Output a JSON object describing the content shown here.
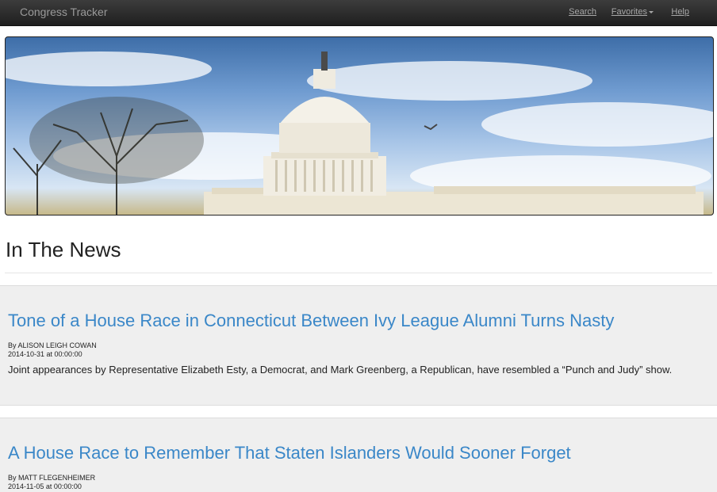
{
  "app": {
    "brand": "Congress Tracker"
  },
  "nav": {
    "search": "Search",
    "favorites": "Favorites",
    "help": "Help"
  },
  "page": {
    "heading": "In The News"
  },
  "articles": [
    {
      "headline": "Tone of a House Race in Connecticut Between Ivy League Alumni Turns Nasty",
      "byline": "By ALISON LEIGH COWAN",
      "date": "2014-10-31 at 00:00:00",
      "summary": "Joint appearances by Representative Elizabeth Esty, a Democrat, and Mark Greenberg, a Republican, have resembled a “Punch and Judy” show."
    },
    {
      "headline": "A House Race to Remember That Staten Islanders Would Sooner Forget",
      "byline": "By MATT FLEGENHEIMER",
      "date": "2014-11-05 at 00:00:00"
    }
  ],
  "colors": {
    "navbar": "#2a2a2a",
    "link": "#3a87c8",
    "article_bg": "#efefef"
  }
}
